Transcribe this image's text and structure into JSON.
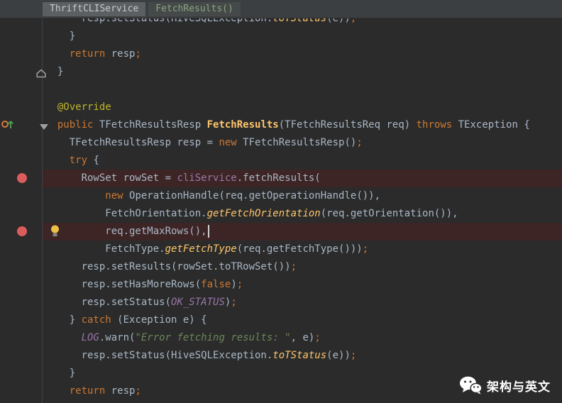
{
  "breadcrumbs": {
    "class_chip": "ThriftCLIService",
    "method_chip": "FetchResults()"
  },
  "colors": {
    "topbar_bg": "#3c3f41",
    "editor_bg": "#2b2b2b",
    "gutter_bg": "#2b2b2b",
    "breakpoint_line_bg": "#3d2525",
    "default_text": "#a9b7c6",
    "keyword": "#cc7832",
    "annotation": "#bbb529",
    "string": "#6a8759",
    "method_decl": "#ffc66b",
    "static_member": "#9876aa",
    "breakpoint_red": "#db5c5c",
    "bulb_yellow": "#ecc244"
  },
  "icons": {
    "breakpoint": "breakpoint-icon",
    "intention_bulb": "intention-bulb-icon",
    "override_marker": "overriding-method-icon",
    "fold_down": "fold-arrow-down-icon",
    "fold_end": "fold-region-end-icon",
    "wechat": "wechat-icon"
  },
  "watermark": {
    "text": "架构与英文"
  },
  "editor": {
    "lines": [
      {
        "seg": [
          [
            "      resp.setStatus(HiveSQLException.",
            "d"
          ],
          [
            "toTStatus",
            "sm"
          ],
          [
            "(e))",
            "d"
          ],
          [
            ";",
            "k"
          ]
        ]
      },
      {
        "seg": [
          [
            "    }",
            "d"
          ]
        ]
      },
      {
        "seg": [
          [
            "    ",
            "d"
          ],
          [
            "return",
            "k"
          ],
          [
            " resp",
            "d"
          ],
          [
            ";",
            "k"
          ]
        ]
      },
      {
        "seg": [
          [
            "  }",
            "d"
          ]
        ]
      },
      {
        "seg": []
      },
      {
        "seg": [
          [
            "  ",
            "d"
          ],
          [
            "@Override",
            "a"
          ]
        ]
      },
      {
        "seg": [
          [
            "  ",
            "d"
          ],
          [
            "public ",
            "k"
          ],
          [
            "TFetchResultsResp ",
            "d"
          ],
          [
            "FetchResults",
            "m"
          ],
          [
            "(TFetchResultsReq req) ",
            "d"
          ],
          [
            "throws",
            "k"
          ],
          [
            " TException {",
            "d"
          ]
        ]
      },
      {
        "seg": [
          [
            "    TFetchResultsResp resp = ",
            "d"
          ],
          [
            "new",
            "k"
          ],
          [
            " TFetchResultsResp()",
            "d"
          ],
          [
            ";",
            "k"
          ]
        ]
      },
      {
        "seg": [
          [
            "    ",
            "d"
          ],
          [
            "try",
            "k"
          ],
          [
            " {",
            "d"
          ]
        ]
      },
      {
        "hl": true,
        "seg": [
          [
            "      RowSet rowSet = ",
            "d"
          ],
          [
            "cliService",
            "f"
          ],
          [
            ".fetchResults(",
            "d"
          ]
        ]
      },
      {
        "seg": [
          [
            "          ",
            "d"
          ],
          [
            "new",
            "k"
          ],
          [
            " OperationHandle(req.getOperationHandle()),",
            "d"
          ]
        ]
      },
      {
        "seg": [
          [
            "          FetchOrientation.",
            "d"
          ],
          [
            "getFetchOrientation",
            "sm"
          ],
          [
            "(req.getOrientation()),",
            "d"
          ]
        ]
      },
      {
        "hl": true,
        "cursor": true,
        "seg": [
          [
            "          req.getMaxRows(),",
            "d"
          ]
        ]
      },
      {
        "seg": [
          [
            "          FetchType.",
            "d"
          ],
          [
            "getFetchType",
            "sm"
          ],
          [
            "(req.getFetchType()))",
            "d"
          ],
          [
            ";",
            "k"
          ]
        ]
      },
      {
        "seg": [
          [
            "      resp.setResults(rowSet.toTRowSet())",
            "d"
          ],
          [
            ";",
            "k"
          ]
        ]
      },
      {
        "seg": [
          [
            "      resp.setHasMoreRows(",
            "d"
          ],
          [
            "false",
            "k"
          ],
          [
            ")",
            "d"
          ],
          [
            ";",
            "k"
          ]
        ]
      },
      {
        "seg": [
          [
            "      resp.setStatus(",
            "d"
          ],
          [
            "OK_STATUS",
            "sf"
          ],
          [
            ")",
            "d"
          ],
          [
            ";",
            "k"
          ]
        ]
      },
      {
        "seg": [
          [
            "    } ",
            "d"
          ],
          [
            "catch",
            "k"
          ],
          [
            " (Exception e) {",
            "d"
          ]
        ]
      },
      {
        "seg": [
          [
            "      ",
            "d"
          ],
          [
            "LOG",
            "sf"
          ],
          [
            ".warn(",
            "d"
          ],
          [
            "\"Error fetching results: \"",
            "s"
          ],
          [
            ", e)",
            "d"
          ],
          [
            ";",
            "k"
          ]
        ]
      },
      {
        "seg": [
          [
            "      resp.setStatus(HiveSQLException.",
            "d"
          ],
          [
            "toTStatus",
            "sm"
          ],
          [
            "(e))",
            "d"
          ],
          [
            ";",
            "k"
          ]
        ]
      },
      {
        "seg": [
          [
            "    }",
            "d"
          ]
        ]
      },
      {
        "seg": [
          [
            "    ",
            "d"
          ],
          [
            "return",
            "k"
          ],
          [
            " resp",
            "d"
          ],
          [
            ";",
            "k"
          ]
        ]
      }
    ]
  }
}
